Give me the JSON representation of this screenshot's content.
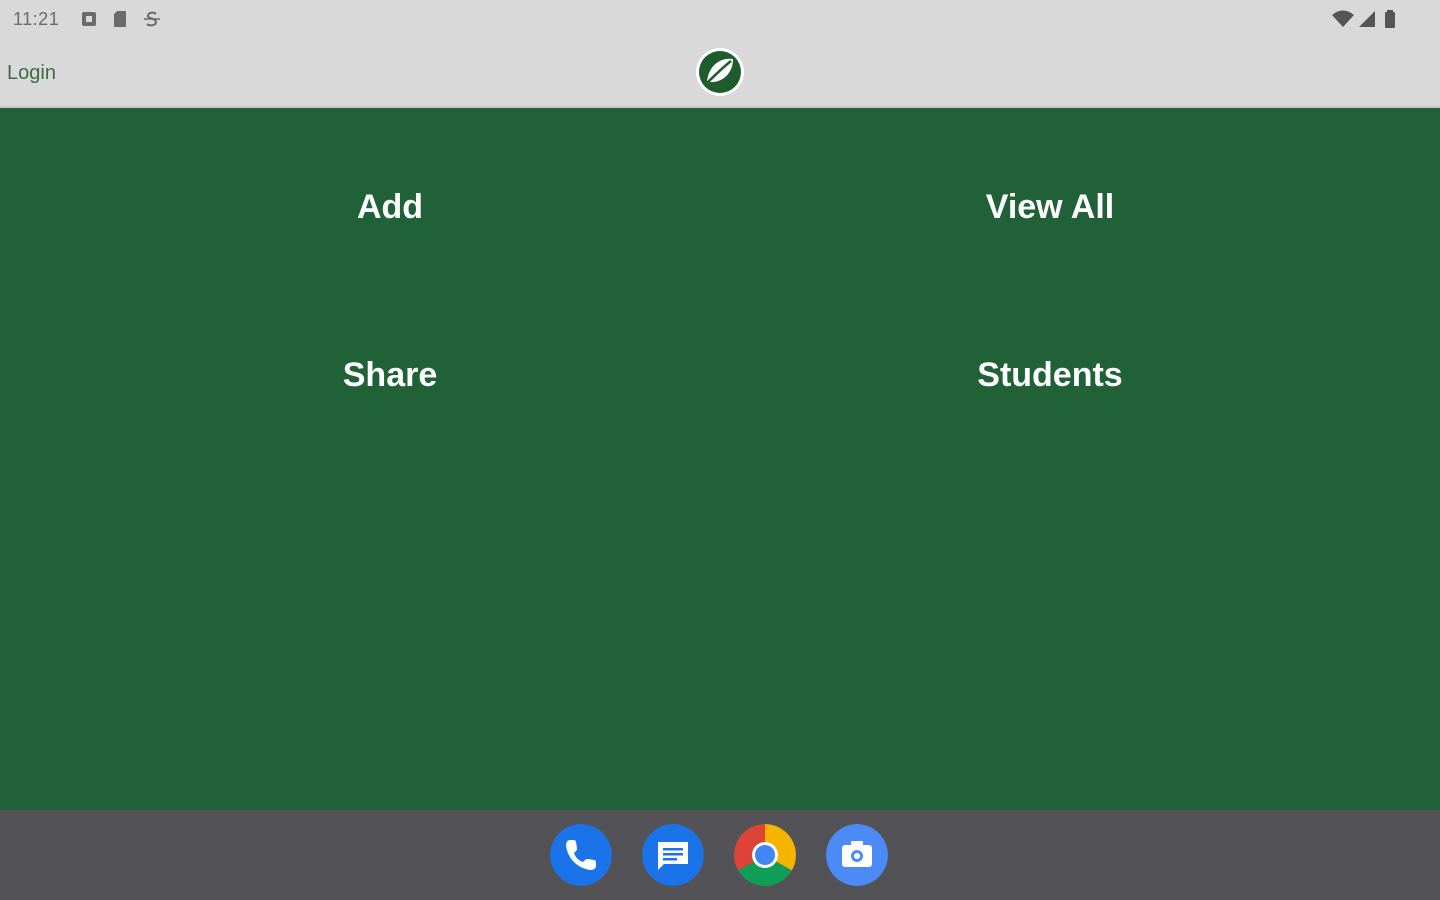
{
  "status_bar": {
    "time": "11:21"
  },
  "app_bar": {
    "login_label": "Login",
    "logo_icon": "leaf-logo-icon"
  },
  "menu": {
    "add_label": "Add",
    "view_all_label": "View All",
    "share_label": "Share",
    "students_label": "Students"
  },
  "dock": {
    "apps": [
      "phone-icon",
      "messages-icon",
      "chrome-icon",
      "camera-icon"
    ]
  },
  "colors": {
    "primary_green": "#216137",
    "bar_gray": "#d9d9d9",
    "dock_gray": "#525257"
  }
}
